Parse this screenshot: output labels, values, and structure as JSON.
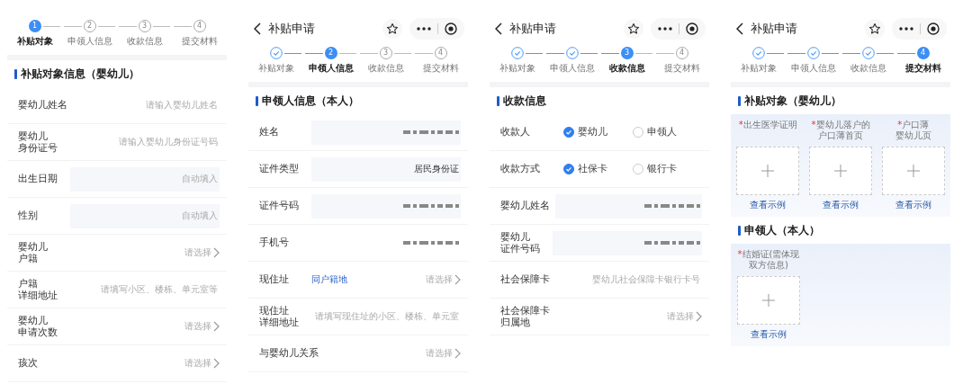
{
  "screens": [
    {
      "steps": [
        {
          "number": "1",
          "label": "补贴对象",
          "done": false,
          "selected": true
        },
        {
          "number": "2",
          "label": "申领人信息",
          "done": false,
          "selected": false
        },
        {
          "number": "3",
          "label": "收款信息",
          "done": false,
          "selected": false
        },
        {
          "number": "4",
          "label": "提交材料",
          "done": false,
          "selected": false
        }
      ],
      "sections": [
        {
          "title": "补贴对象信息（婴幼儿）",
          "kind": "form",
          "rows": [
            {
              "kind": "input",
              "label_lines": [
                "婴幼儿姓名"
              ],
              "placeholder": "请输入婴幼儿姓名"
            },
            {
              "kind": "input",
              "label_lines": [
                "婴幼儿",
                "身份证号"
              ],
              "placeholder": "请输入婴幼儿身份证号码"
            },
            {
              "kind": "readonly",
              "label_lines": [
                "出生日期"
              ],
              "placeholder": "自动填入"
            },
            {
              "kind": "readonly",
              "label_lines": [
                "性别"
              ],
              "placeholder": "自动填入"
            },
            {
              "kind": "select",
              "label_lines": [
                "婴幼儿",
                "户籍"
              ],
              "placeholder": "请选择"
            },
            {
              "kind": "input",
              "label_lines": [
                "户籍",
                "详细地址"
              ],
              "placeholder": "请填写小区、楼栋、单元室等"
            },
            {
              "kind": "select",
              "label_lines": [
                "婴幼儿",
                "申请次数"
              ],
              "placeholder": "请选择"
            },
            {
              "kind": "select",
              "label_lines": [
                "孩次"
              ],
              "placeholder": "请选择"
            }
          ]
        }
      ]
    },
    {
      "header": {
        "title": "补贴申请"
      },
      "steps": [
        {
          "label": "补贴对象",
          "done": true,
          "selected": false
        },
        {
          "number": "2",
          "label": "申领人信息",
          "done": false,
          "selected": true
        },
        {
          "number": "3",
          "label": "收款信息",
          "done": false,
          "selected": false
        },
        {
          "number": "4",
          "label": "提交材料",
          "done": false,
          "selected": false
        }
      ],
      "sections": [
        {
          "title": "申领人信息（本人）",
          "kind": "form",
          "rows": [
            {
              "kind": "readonly",
              "label_lines": [
                "姓名"
              ],
              "masked": true
            },
            {
              "kind": "readonly",
              "label_lines": [
                "证件类型"
              ],
              "value": "居民身份证"
            },
            {
              "kind": "readonly",
              "label_lines": [
                "证件号码"
              ],
              "masked": true
            },
            {
              "kind": "input",
              "label_lines": [
                "手机号"
              ],
              "masked": true
            },
            {
              "kind": "select",
              "label_lines": [
                "现住址"
              ],
              "note": "同户籍地",
              "placeholder": "请选择"
            },
            {
              "kind": "input",
              "label_lines": [
                "现住址",
                "详细地址"
              ],
              "placeholder": "请填写现住址的小区、楼栋、单元室"
            },
            {
              "kind": "select",
              "label_lines": [
                "与婴幼儿关系"
              ],
              "placeholder": "请选择"
            }
          ]
        }
      ]
    },
    {
      "header": {
        "title": "补贴申请"
      },
      "steps": [
        {
          "label": "补贴对象",
          "done": true,
          "selected": false
        },
        {
          "label": "申领人信息",
          "done": true,
          "selected": false
        },
        {
          "number": "3",
          "label": "收款信息",
          "done": false,
          "selected": true
        },
        {
          "number": "4",
          "label": "提交材料",
          "done": false,
          "selected": false
        }
      ],
      "sections": [
        {
          "title": "收款信息",
          "kind": "form",
          "rows": [
            {
              "kind": "radio",
              "label_lines": [
                "收款人"
              ],
              "options": [
                {
                  "label": "婴幼儿",
                  "selected": true
                },
                {
                  "label": "申领人",
                  "selected": false
                }
              ]
            },
            {
              "kind": "radio",
              "label_lines": [
                "收款方式"
              ],
              "options": [
                {
                  "label": "社保卡",
                  "selected": true
                },
                {
                  "label": "银行卡",
                  "selected": false
                }
              ]
            },
            {
              "kind": "readonly",
              "label_lines": [
                "婴幼儿姓名"
              ],
              "masked": true
            },
            {
              "kind": "readonly",
              "label_lines": [
                "婴幼儿",
                "证件号码"
              ],
              "masked": true
            },
            {
              "kind": "input",
              "label_lines": [
                "社会保障卡"
              ],
              "placeholder": "婴幼儿社会保障卡银行卡号"
            },
            {
              "kind": "select",
              "label_lines": [
                "社会保障卡",
                "归属地"
              ],
              "placeholder": "请选择"
            }
          ]
        }
      ]
    },
    {
      "header": {
        "title": "补贴申请"
      },
      "steps": [
        {
          "label": "补贴对象",
          "done": true,
          "selected": false
        },
        {
          "label": "申领人信息",
          "done": true,
          "selected": false
        },
        {
          "label": "收款信息",
          "done": true,
          "selected": false
        },
        {
          "number": "4",
          "label": "提交材料",
          "done": false,
          "selected": true
        }
      ],
      "sections": [
        {
          "title": "补贴对象（婴幼儿）",
          "kind": "uploads",
          "items": [
            {
              "required_mark": "*",
              "label_lines": [
                "出生医学证明"
              ],
              "link": "查看示例"
            },
            {
              "required_mark": "*",
              "label_lines": [
                "婴幼儿落户的户口薄首页"
              ],
              "link": "查看示例"
            },
            {
              "required_mark": "*",
              "label_lines": [
                "户口薄",
                "婴幼儿页"
              ],
              "link": "查看示例"
            }
          ]
        },
        {
          "title": "申领人（本人）",
          "kind": "uploads",
          "items": [
            {
              "required_mark": "*",
              "label_lines": [
                "结婚证(需体现双方信息)"
              ],
              "link": "查看示例"
            }
          ]
        }
      ]
    }
  ]
}
